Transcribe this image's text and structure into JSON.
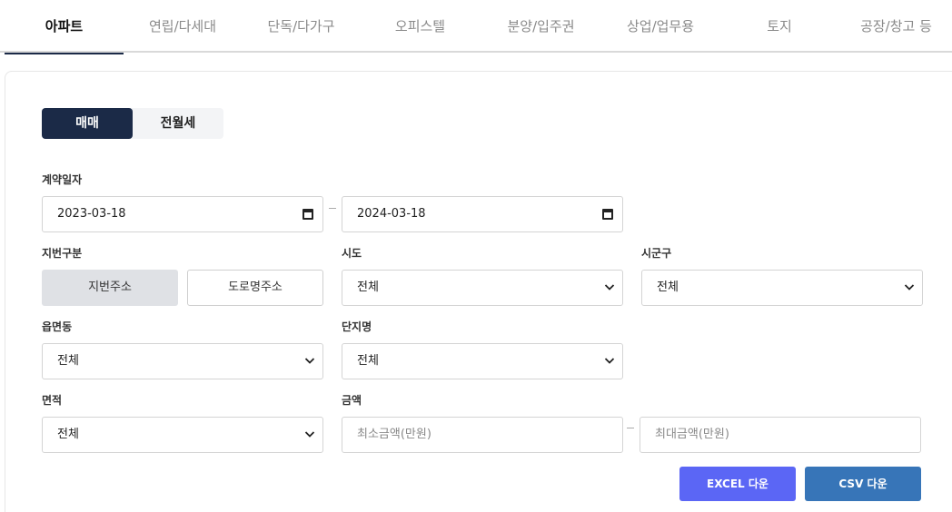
{
  "tabs": [
    "아파트",
    "연립/다세대",
    "단독/다가구",
    "오피스텔",
    "분양/입주권",
    "상업/업무용",
    "토지",
    "공장/창고 등"
  ],
  "deal_type": {
    "sale": "매매",
    "rent": "전월세"
  },
  "labels": {
    "contract_date": "계약일자",
    "lot_type": "지번구분",
    "sido": "시도",
    "sigungu": "시군구",
    "eupmyeondong": "읍면동",
    "complex": "단지명",
    "area": "면적",
    "amount": "금액"
  },
  "dates": {
    "start": "2023-03-18",
    "end": "2024-03-18"
  },
  "lot_toggle": {
    "jibun": "지번주소",
    "road": "도로명주소"
  },
  "selects": {
    "sido": "전체",
    "sigungu": "전체",
    "eupmyeondong": "전체",
    "complex": "전체",
    "area": "전체"
  },
  "amount": {
    "min_placeholder": "최소금액(만원)",
    "max_placeholder": "최대금액(만원)"
  },
  "buttons": {
    "excel": "EXCEL 다운",
    "csv": "CSV 다운"
  },
  "colors": {
    "primary": "#1b2a47",
    "excel": "#5b66f5",
    "csv": "#3775b8"
  }
}
